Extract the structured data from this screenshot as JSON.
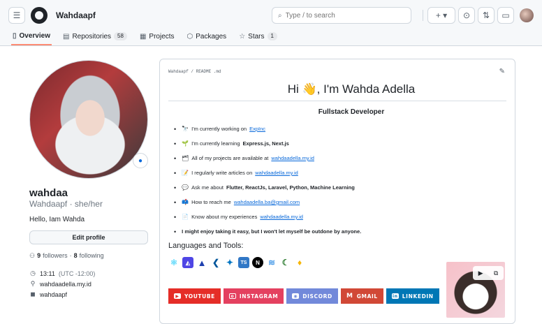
{
  "header": {
    "username": "Wahdaapf",
    "search_placeholder": "Type / to search",
    "menu_icon": "hamburger-icon",
    "logo_icon": "github-logo-icon"
  },
  "nav": {
    "tabs": [
      {
        "label": "Overview",
        "icon": "book-icon"
      },
      {
        "label": "Repositories",
        "icon": "repo-icon",
        "count": "58"
      },
      {
        "label": "Projects",
        "icon": "table-icon"
      },
      {
        "label": "Packages",
        "icon": "package-icon"
      },
      {
        "label": "Stars",
        "icon": "star-icon",
        "count": "1"
      }
    ],
    "active_tab_color": "#fd8c73"
  },
  "sidebar": {
    "name": "wahdaa",
    "login": "Wahdaapf · she/her",
    "bio": "Hello, Iam Wahda",
    "edit_label": "Edit profile",
    "followers": "9",
    "followers_label": "followers",
    "following": "8",
    "following_label": "following",
    "time": "13:11",
    "tz": "(UTC -12:00)",
    "website": "wahdaadella.my.id",
    "social": "wahdaapf"
  },
  "readme": {
    "crumb": "Wahdaapf / README .md",
    "title": "Hi 👋, I'm Wahda Adella",
    "subtitle": "Fullstack Developer",
    "items": {
      "i1_text": "I'm currently working on",
      "i1_link": "ExpInc",
      "i2_text": "I'm currently learning",
      "i2_bold": "Express.js, Next.js",
      "i3_text": "All of my projects are available at",
      "i3_link": "wahdaadella.my.id",
      "i4_text": "I regularly write articles on",
      "i4_link": "wahdaadella.my.id",
      "i5_text": "Ask me about",
      "i5_bold": "Flutter, ReactJs, Laravel, Python, Machine Learning",
      "i6_text": "How to reach me",
      "i6_link": "wahdaadella.ba@gmail.com",
      "i7_text": "Know about my experiences",
      "i7_link": "wahdaadella.my.id",
      "i8_bold": "I might enjoy taking it easy, but I won't let myself be outdone by anyone."
    },
    "tools_heading": "Languages and Tools:",
    "badges": {
      "youtube": "YOUTUBE",
      "instagram": "INSTAGRAM",
      "discord": "DISCORD",
      "gmail": "GMAIL",
      "linkedin": "LINKEDIN"
    },
    "badge_colors": {
      "youtube": "#e52d27",
      "instagram": "#e4405f",
      "discord": "#7289da",
      "gmail": "#d14836",
      "linkedin": "#0077b5"
    }
  }
}
